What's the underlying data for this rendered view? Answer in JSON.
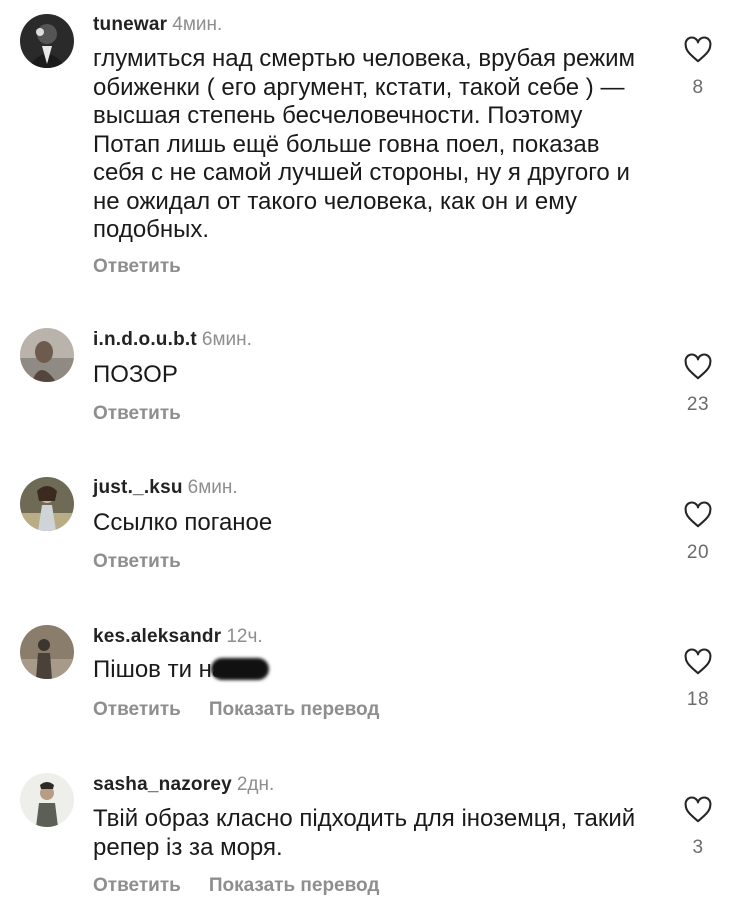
{
  "comments": [
    {
      "username": "tunewar",
      "time": "4мин.",
      "text": "глумиться над смертью человека, врубая режим обиженки ( его аргумент, кстати, такой себе ) — высшая степень бесчеловечности. Поэтому Потап лишь ещё больше говна поел, показав себя с не самой лучшей стороны, ну я другого и не ожидал от такого человека, как он и ему подобных.",
      "reply": "Ответить",
      "likes": "8"
    },
    {
      "username": "i.n.d.o.u.b.t",
      "time": "6мин.",
      "text": "ПОЗОР",
      "reply": "Ответить",
      "likes": "23"
    },
    {
      "username": "just._.ksu",
      "time": "6мин.",
      "text": "Ссылко поганое",
      "reply": "Ответить",
      "likes": "20"
    },
    {
      "username": "kes.aleksandr",
      "time": "12ч.",
      "text": "Пішов ти на",
      "reply": "Ответить",
      "translate": "Показать перевод",
      "likes": "18"
    },
    {
      "username": "sasha_nazorey",
      "time": "2дн.",
      "text": "Твій образ класно підходить для іноземця, такий репер із за моря.",
      "reply": "Ответить",
      "translate": "Показать перевод",
      "likes": "3"
    }
  ],
  "icons": {
    "like": "heart-outline-icon"
  },
  "colors": {
    "muted": "#8e8e8e",
    "text": "#1a1a1a"
  }
}
